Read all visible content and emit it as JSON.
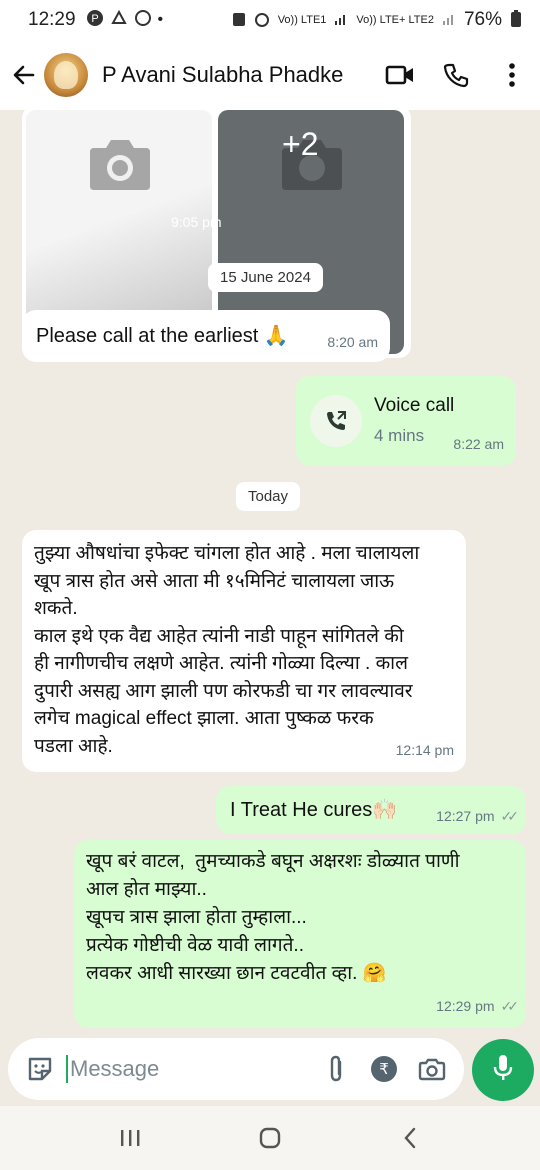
{
  "status_bar": {
    "time": "12:29",
    "network_1": "Vo)) LTE1",
    "network_2": "Vo)) LTE+ LTE2",
    "battery": "76%"
  },
  "header": {
    "contact_name": "P Avani Sulabha Phadke",
    "icons": [
      "back-arrow-icon",
      "video-call-icon",
      "phone-icon",
      "more-vert-icon"
    ]
  },
  "media_message": {
    "more_count": "+2",
    "time": "9:05 pm"
  },
  "date_chips": {
    "first": "15 June 2024",
    "second": "Today"
  },
  "messages": [
    {
      "direction": "incoming",
      "text": "Please call at the earliest 🙏",
      "time": "8:20 am"
    },
    {
      "direction": "outgoing",
      "type": "voice-call",
      "title": "Voice call",
      "duration": "4 mins",
      "time": "8:22 am"
    },
    {
      "direction": "incoming",
      "text": "तुझ्या औषधांचा इफेक्ट चांगला होत आहे . मला चालायला\nखूप त्रास होत असे आता मी १५मिनिटं चालायला जाऊ\nशकते.\nकाल इथे एक वैद्य आहेत त्यांनी नाडी पाहून सांगितले की\nही नागीणचीच लक्षणे आहेत. त्यांनी गोळ्या दिल्या . काल\nदुपारी असह्य आग झाली पण कोरफडी चा गर लावल्यावर\nलगेच magical effect झाला. आता पुष्कळ फरक\nपडला आहे.",
      "time": "12:14 pm"
    },
    {
      "direction": "outgoing",
      "text": "I Treat He cures🙌🏻",
      "time": "12:27 pm"
    },
    {
      "direction": "outgoing",
      "text": "खूप बरं वाटल,  तुमच्याकडे बघून अक्षरशः डोळ्यात पाणी\nआल होत माझ्या..\nखूपच त्रास झाला होता तुम्हाला...\nप्रत्येक गोष्टीची वेळ यावी लागते..\nलवकर आधी सारख्या छान टवटवीत व्हा. 🤗",
      "time": "12:29 pm"
    }
  ],
  "composer": {
    "placeholder": "Message"
  },
  "colors": {
    "chat_background": "#efeae2",
    "outgoing_bubble": "#d9fdd3",
    "incoming_bubble": "#ffffff",
    "mic_button": "#1daa61"
  }
}
